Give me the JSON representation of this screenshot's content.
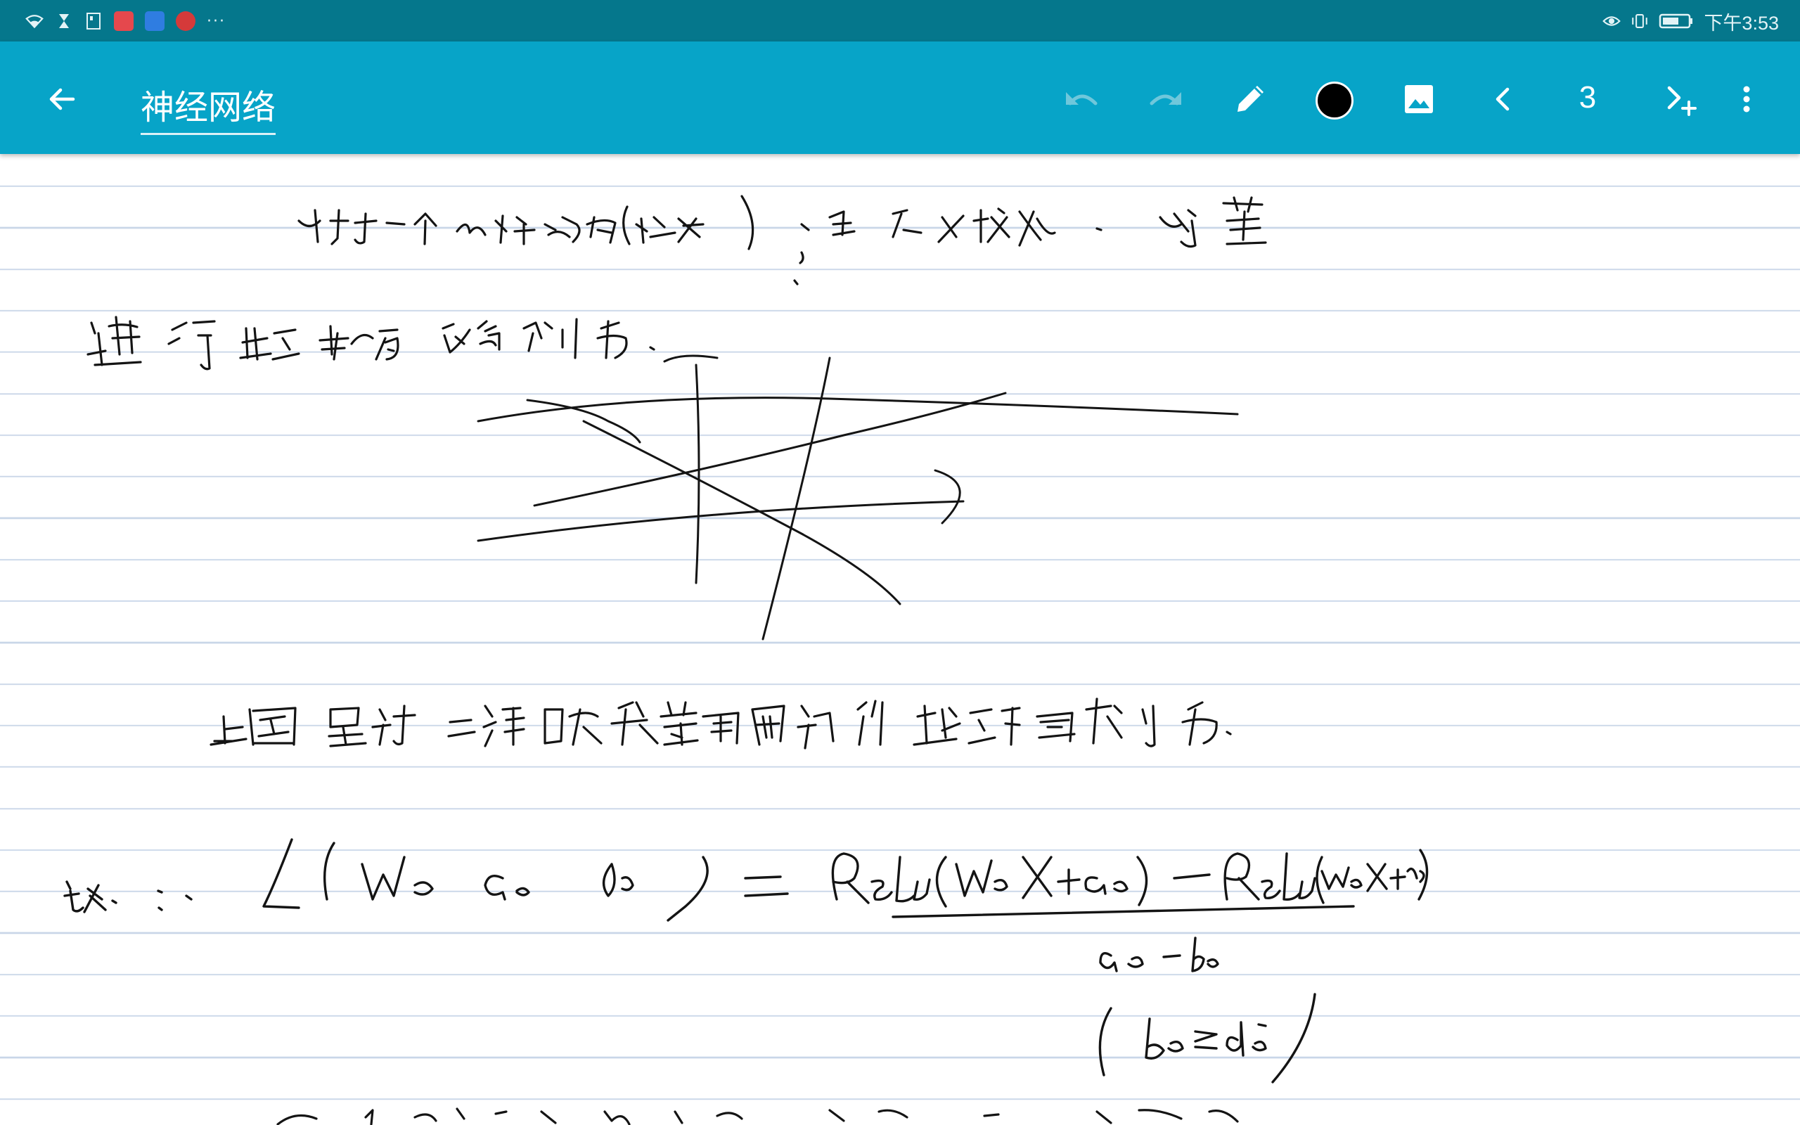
{
  "status_bar": {
    "more_indicator": "···",
    "time": "下午3:53"
  },
  "app_bar": {
    "title": "神经网络",
    "page_number": "3",
    "pen_color": "#000000",
    "accent_color": "#07a4c8",
    "status_color": "#05778c"
  },
  "icons": {
    "back": "arrow-left-icon",
    "undo": "undo-icon",
    "redo": "redo-icon",
    "pen": "pencil-icon",
    "image": "image-icon",
    "prev": "chevron-left-icon",
    "next_add": "next-add-page-icon",
    "menu": "more-vert-icon"
  }
}
